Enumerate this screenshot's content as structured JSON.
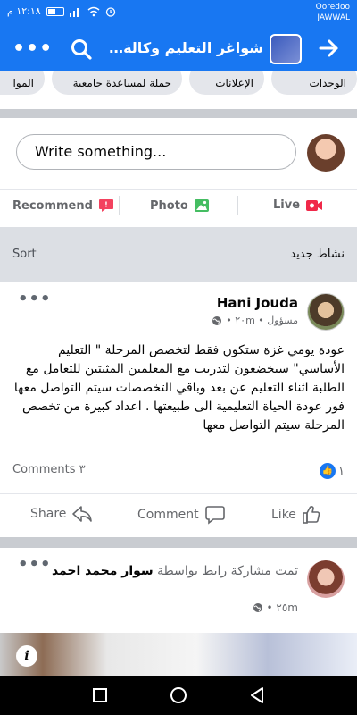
{
  "status_bar": {
    "time": "١٢:١٨ م",
    "carrier_1": "Ooredoo",
    "carrier_2": "JAWWAL"
  },
  "header": {
    "title": "شواغر التعليم وكالة الغ...",
    "more_label": "•••"
  },
  "topic_chips": [
    "الوحدات",
    "الإعلانات",
    "حملة لمساعدة جامعية",
    "الموا"
  ],
  "composer": {
    "placeholder": "Write something...",
    "recommend_label": "Recommend",
    "photo_label": "Photo",
    "live_label": "Live"
  },
  "feed_bar": {
    "sort_label": "Sort",
    "new_activity_label": "نشاط جديد"
  },
  "posts": [
    {
      "author": "Hani Jouda",
      "meta": "مسؤول • ٢٠m •",
      "text": "عودة يومي غزة ستكون فقط لتخصص المرحلة \" التعليم الأساسي\" سيخضعون لتدريب مع المعلمين المثبتين للتعامل مع الطلبة اثناء التعليم عن بعد وباقي التخصصات سيتم التواصل معها فور عودة الحياة التعليمية الى طبيعتها . اعداد كبيرة من تخصص المرحلة سيتم التواصل معها",
      "comments_label": "Comments ٣",
      "like_count": "١",
      "share_label": "Share",
      "comment_label": "Comment",
      "like_label": "Like"
    },
    {
      "prefix": "تمت مشاركة رابط بواسطة",
      "author": "سوار محمد احمد",
      "time": "٢٥m •"
    }
  ],
  "colors": {
    "brand": "#1877f2",
    "live_red": "#f02849",
    "recommend_red": "#f3425f",
    "photo_green": "#45bd62"
  }
}
